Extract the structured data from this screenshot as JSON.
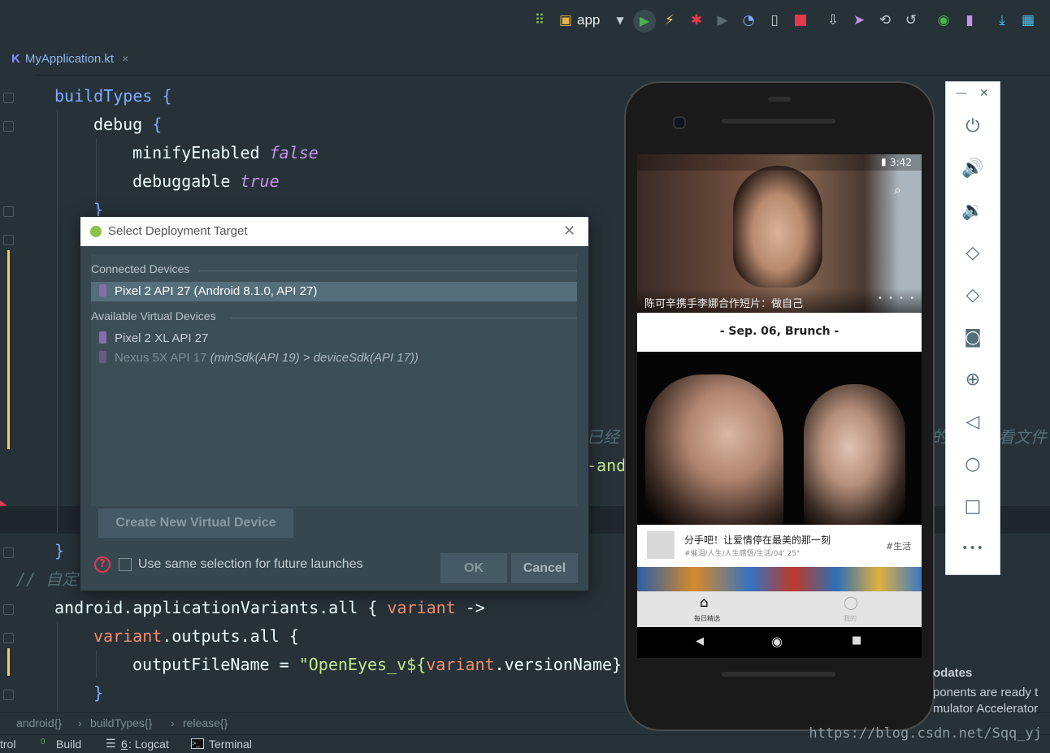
{
  "toolbar": {
    "run_config": "app"
  },
  "tab": {
    "filename": "MyApplication.kt",
    "close": "×"
  },
  "code": {
    "l1a": "buildTypes",
    "l1b": " {",
    "l2a": "debug",
    "l2b": " {",
    "l3a": "minifyEnabled ",
    "l3b": "false",
    "l4a": "debuggable ",
    "l4b": "true",
    "l5": "}",
    "l6": "}",
    "l7a": "// 自定",
    "l8a": "android.applicationVariants.all { ",
    "l8b": "variant",
    "l8c": " ->",
    "l9a": "variant",
    "l9b": ".outputs.all {",
    "l10a": "outputFileName = ",
    "l10b": "\"OpenEyes_v${",
    "l10c": "variant",
    "l10d": ".versionName}",
    "l11": "}",
    "frag1": "已经",
    "frag2": "-andı",
    "frag3": "的",
    "frag4": "看文件"
  },
  "dialog": {
    "title": "Select Deployment Target",
    "connected_header": "Connected Devices",
    "connected": [
      "Pixel 2 API 27 (Android 8.1.0, API 27)"
    ],
    "virtual_header": "Available Virtual Devices",
    "virtual_ok": "Pixel 2 XL API 27",
    "virtual_disabled_name": "Nexus 5X API 17",
    "virtual_disabled_reason": "(minSdk(API 19) > deviceSdk(API 17))",
    "create_button": "Create New Virtual Device",
    "checkbox_label": "Use same selection for future launches",
    "ok": "OK",
    "cancel": "Cancel"
  },
  "phone": {
    "time": "3:42",
    "banner_caption": "陈可辛携手李娜合作短片：做自己",
    "date_header": "- Sep. 06, Brunch -",
    "card_title": "分手吧！让爱情停在最美的那一刻",
    "card_meta": "#催泪/人生/人生感悟/生活/04' 25\"",
    "card_tag": "#生活",
    "nav_home": "每日精选",
    "nav_me": "我的"
  },
  "emulator": {
    "minimize": "—",
    "close": "✕",
    "more": "•••"
  },
  "breadcrumb": [
    "android{}",
    "buildTypes{}",
    "release{}"
  ],
  "bottom": {
    "control": "trol",
    "build": "Build",
    "build_num": "0",
    "logcat_num": "6",
    "logcat": ": Logcat",
    "terminal": "Terminal"
  },
  "notification": {
    "title": "odates",
    "line1": "ponents are ready t",
    "line2": "mulator Accelerator"
  },
  "watermark": "https://blog.csdn.net/Sqq_yj",
  "colors": {
    "bg": "#263238",
    "accent": "#f9c859",
    "keyword": "#82aaff",
    "literal": "#c792ea",
    "string": "#c3e88d"
  }
}
